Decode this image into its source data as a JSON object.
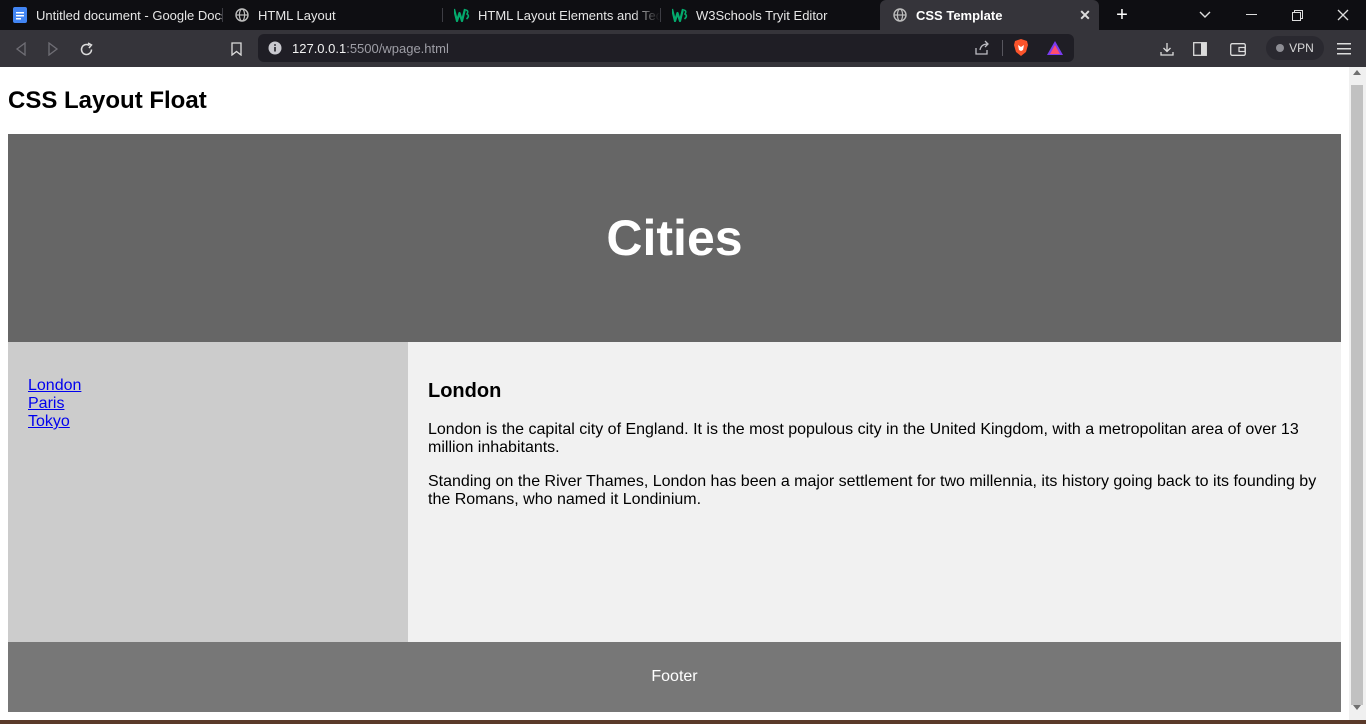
{
  "browser": {
    "tabs": [
      {
        "label": "Untitled document - Google Docs",
        "icon": "google-docs-icon"
      },
      {
        "label": "HTML Layout",
        "icon": "globe-icon"
      },
      {
        "label": "HTML Layout Elements and Techniques",
        "icon": "w3schools-icon"
      },
      {
        "label": "W3Schools Tryit Editor",
        "icon": "w3schools-icon"
      },
      {
        "label": "CSS Template",
        "icon": "globe-icon",
        "active": true
      }
    ],
    "url": {
      "host": "127.0.0.1",
      "rest": ":5500/wpage.html"
    },
    "vpn_label": "VPN"
  },
  "page": {
    "heading": "CSS Layout Float",
    "header_title": "Cities",
    "nav_links": [
      "London",
      "Paris",
      "Tokyo"
    ],
    "article": {
      "title": "London",
      "paragraphs": [
        "London is the capital city of England. It is the most populous city in the United Kingdom, with a metropolitan area of over 13 million inhabitants.",
        "Standing on the River Thames, London has been a major settlement for two millennia, its history going back to its founding by the Romans, who named it Londinium."
      ]
    },
    "footer": "Footer"
  },
  "colors": {
    "header_bg": "#666666",
    "nav_bg": "#cccccc",
    "article_bg": "#f1f1f1",
    "footer_bg": "#777777",
    "link": "#0000ee"
  }
}
